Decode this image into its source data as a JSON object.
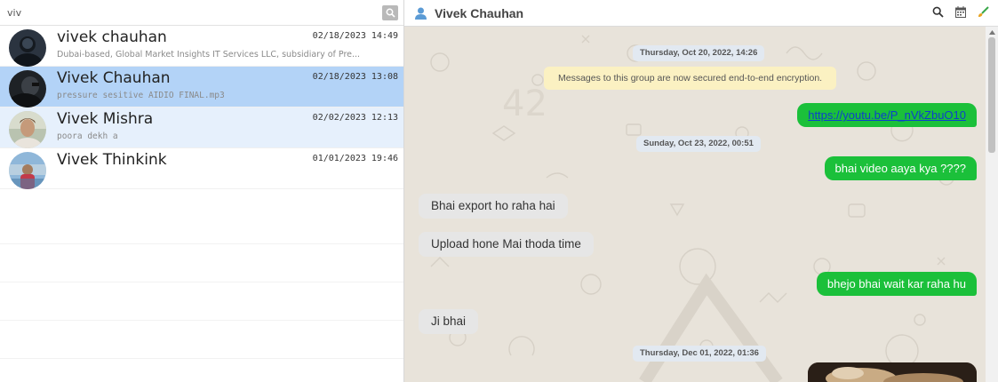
{
  "search": {
    "value": "viv",
    "icon": "search-icon"
  },
  "chats": [
    {
      "name": "vivek chauhan",
      "time": "02/18/2023 14:49",
      "preview": "Dubai-based, Global Market Insights IT Services LLC, subsidiary of Pre..."
    },
    {
      "name": "Vivek Chauhan",
      "time": "02/18/2023 13:08",
      "preview": "pressure sesitive AIDIO FINAL.mp3"
    },
    {
      "name": "Vivek Mishra",
      "time": "02/02/2023 12:13",
      "preview": "poora dekh a"
    },
    {
      "name": "Vivek Thinkink",
      "time": "01/01/2023 19:46",
      "preview": ""
    }
  ],
  "header": {
    "name": "Vivek Chauhan",
    "icons": [
      "user-icon",
      "search-icon",
      "calendar-icon",
      "brush-icon"
    ]
  },
  "messages": {
    "date1": "Thursday, Oct 20, 2022, 14:26",
    "system": "Messages to this group are now secured end-to-end encryption.",
    "link": "https://youtu.be/P_nVkZbuO10",
    "date2": "Sunday, Oct 23, 2022, 00:51",
    "out1": "bhai video aaya kya ????",
    "in1": "Bhai export ho raha hai",
    "in2": "Upload hone Mai thoda time",
    "out2": "bhejo bhai wait kar raha hu",
    "in3": "Ji bhai",
    "date3": "Thursday, Dec 01, 2022, 01:36"
  },
  "colors": {
    "selected": "#b3d3f7",
    "highlight": "#e6f0fc",
    "outgoing": "#1bc03a",
    "incoming": "#e6e6e6",
    "system": "#fbf1c2",
    "chat_bg": "#e8e3da"
  }
}
